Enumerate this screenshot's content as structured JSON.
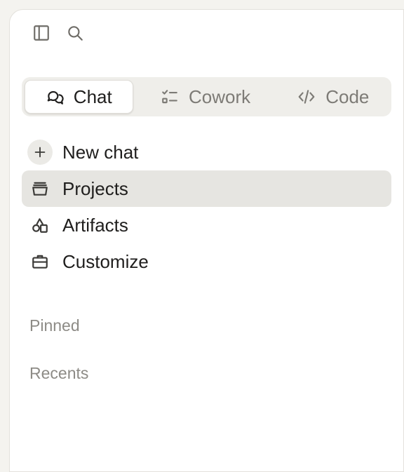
{
  "topbar": {
    "sidebar_toggle_icon": "sidebar-toggle-icon",
    "search_icon": "search-icon"
  },
  "modes": [
    {
      "label": "Chat",
      "icon": "chat-bubbles-icon",
      "active": true
    },
    {
      "label": "Cowork",
      "icon": "checklist-icon",
      "active": false
    },
    {
      "label": "Code",
      "icon": "code-icon",
      "active": false
    }
  ],
  "nav": {
    "items": [
      {
        "label": "New chat",
        "icon": "plus-icon"
      },
      {
        "label": "Projects",
        "icon": "folder-icon",
        "selected": true
      },
      {
        "label": "Artifacts",
        "icon": "shapes-icon"
      },
      {
        "label": "Customize",
        "icon": "briefcase-icon"
      }
    ]
  },
  "sections": {
    "pinned": "Pinned",
    "recents": "Recents"
  },
  "colors": {
    "background": "#f4f3ef",
    "panel": "#ffffff",
    "selected_bg": "#e6e5e1",
    "text": "#1f1e1d",
    "muted_text": "#8d8b86"
  }
}
